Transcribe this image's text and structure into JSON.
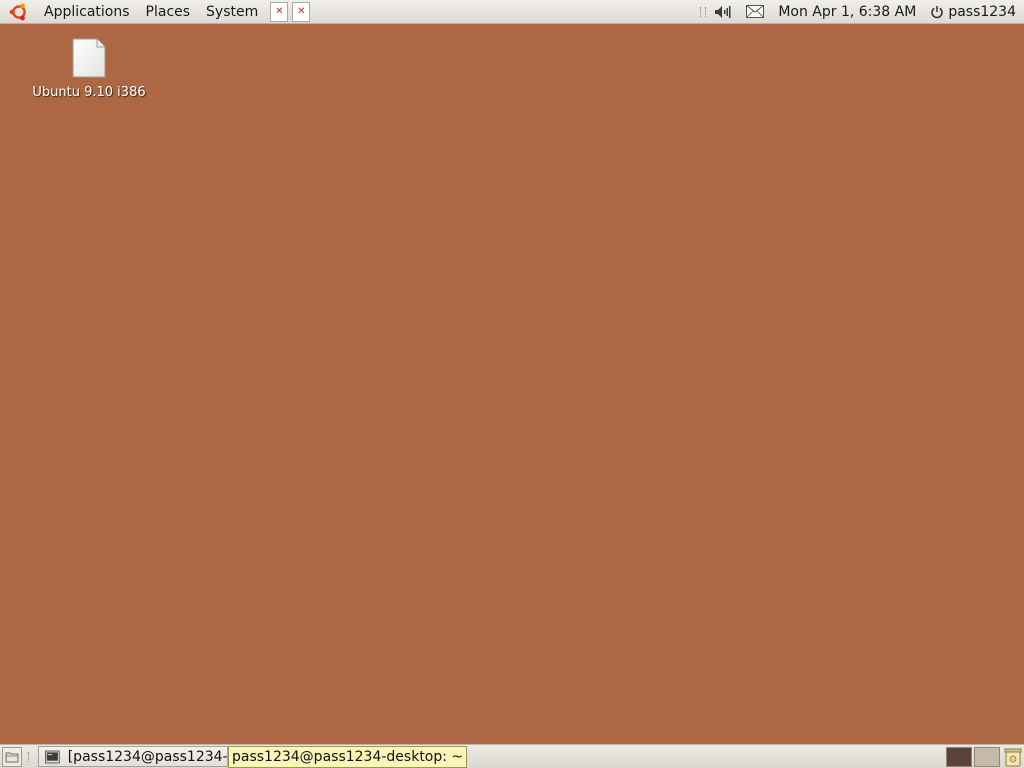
{
  "top_panel": {
    "menus": [
      "Applications",
      "Places",
      "System"
    ],
    "launchers": [
      "document-icon",
      "document-icon"
    ],
    "clock": "Mon Apr  1,  6:38 AM",
    "user": "pass1234",
    "tray_icons": [
      "volume-icon",
      "mail-icon"
    ]
  },
  "desktop": {
    "icon_label": "Ubuntu 9.10 i386",
    "background_color": "#ad6843"
  },
  "bottom_panel": {
    "task_button_label": "[pass1234@pass1234-...",
    "tooltip": "pass1234@pass1234-desktop: ~",
    "workspaces": 2
  }
}
